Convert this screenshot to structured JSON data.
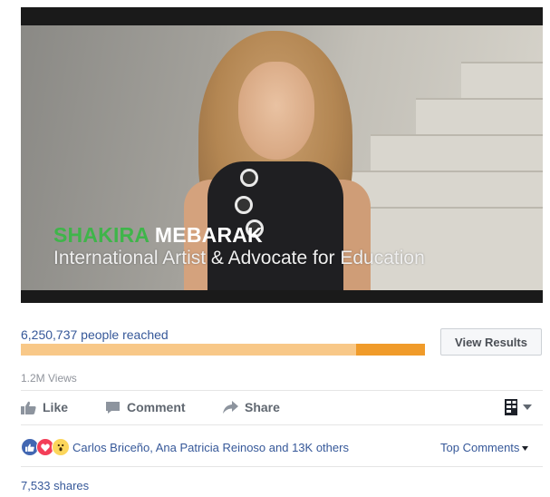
{
  "video": {
    "name_first": "SHAKIRA",
    "name_last": "MEBARAK",
    "title": "International Artist & Advocate for Education"
  },
  "poll": {
    "reach_label": "6,250,737 people reached",
    "bar_fill_fraction": 0.83,
    "bar_colors": {
      "light": "#f8c888",
      "dark": "#f09b2a"
    },
    "view_results_label": "View Results"
  },
  "views_label": "1.2M Views",
  "actions": {
    "like_label": "Like",
    "comment_label": "Comment",
    "share_label": "Share",
    "menu_icon": "page-menu-icon"
  },
  "reactions": {
    "icons": [
      "like-reaction-icon",
      "love-reaction-icon",
      "wow-reaction-icon"
    ],
    "summary": "Carlos Briceño, Ana Patricia Reinoso and 13K others",
    "sort_label": "Top Comments"
  },
  "shares_label": "7,533 shares",
  "colors": {
    "link": "#365899",
    "muted": "#90949c",
    "name_green": "#3fb54a"
  }
}
